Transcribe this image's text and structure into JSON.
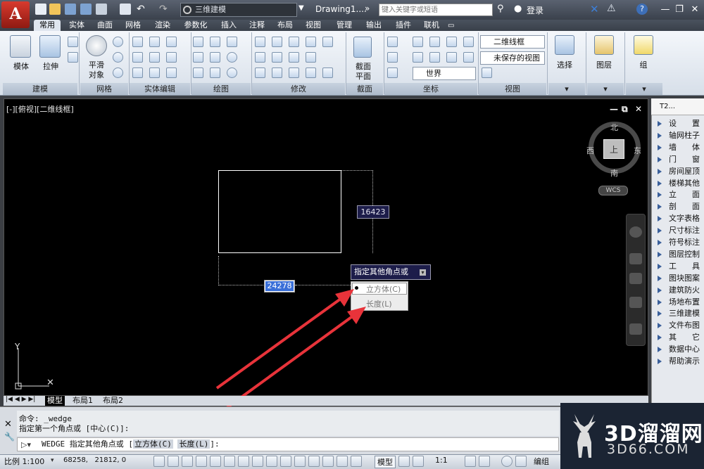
{
  "titlebar": {
    "workspace": "三维建模",
    "document_title": "Drawing1....",
    "search_placeholder": "键入关键字或短语",
    "login": "登录"
  },
  "tabs": [
    "常用",
    "实体",
    "曲面",
    "网格",
    "渲染",
    "参数化",
    "插入",
    "注释",
    "布局",
    "视图",
    "管理",
    "输出",
    "插件",
    "联机"
  ],
  "active_tab": "常用",
  "ribbon": {
    "buttons": {
      "box": "模体",
      "extrude": "拉伸",
      "smooth1": "平滑",
      "smooth2": "对象",
      "section1": "截面",
      "section2": "平面",
      "select": "选择",
      "layers": "图层",
      "group": "组"
    },
    "combos": {
      "visual_style": "二维线框",
      "view_state": "未保存的视图",
      "ucs": "世界"
    },
    "panels": [
      "建模",
      "网格",
      "实体编辑",
      "绘图",
      "修改",
      "截面",
      "坐标",
      "视图"
    ]
  },
  "viewport": {
    "label": "[-][俯视][二维线框]",
    "controls": [
      "—",
      "⧉",
      "✕"
    ],
    "compass": {
      "north": "北",
      "south": "南",
      "west": "西",
      "east": "东",
      "cube_face": "上"
    },
    "wcs": "WCS"
  },
  "drawing": {
    "dim_vertical": "16423",
    "dim_horizontal": "24278",
    "prompt": "指定其他角点或",
    "options": [
      "立方体(C)",
      "长度(L)"
    ]
  },
  "layout_tabs": [
    "模型",
    "布局1",
    "布局2"
  ],
  "palette": {
    "title": "T2...",
    "items": [
      "设　　置",
      "轴网柱子",
      "墙　　体",
      "门　　窗",
      "房间屋顶",
      "楼梯其他",
      "立　　面",
      "剖　　面",
      "文字表格",
      "尺寸标注",
      "符号标注",
      "图层控制",
      "工　　具",
      "图块图案",
      "建筑防火",
      "场地布置",
      "三维建模",
      "文件布图",
      "其　　它",
      "数据中心",
      "帮助演示"
    ]
  },
  "command": {
    "line1": "命令: _wedge",
    "line2": "指定第一个角点或 [中心(C)]:",
    "input_prefix": "WEDGE 指定其他角点或 [",
    "opt1": "立方体(C)",
    "opt2": "长度(L)",
    "input_suffix": "]:"
  },
  "statusbar": {
    "scale": "比例 1:100",
    "coords": "68258,   21812, 0",
    "model": "模型",
    "anno_scale": "1:1",
    "edit": "编组"
  },
  "watermark": {
    "main": "3D溜溜网",
    "sub": "3D66.COM"
  },
  "colors": {
    "arrow": "#e8333a",
    "viewport_bg": "#000000",
    "dim_box": "#1d1d4a",
    "highlight": "#3a6fd8"
  }
}
